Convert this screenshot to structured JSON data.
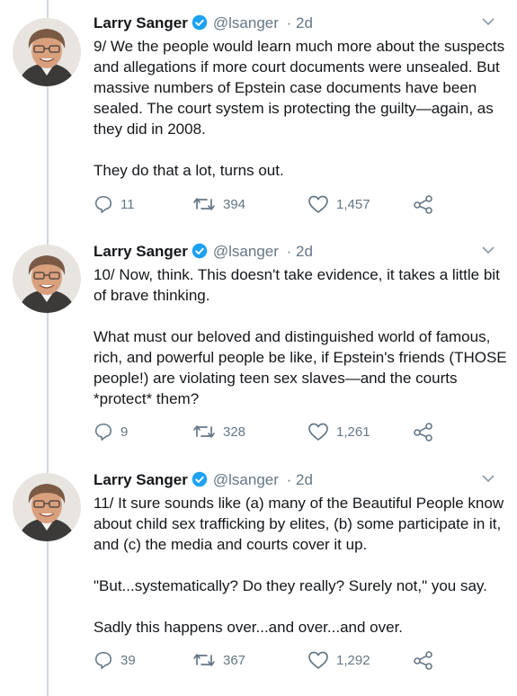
{
  "tweets": [
    {
      "name": "Larry Sanger",
      "handle": "@lsanger",
      "time": "· 2d",
      "text": "9/ We the people would learn much more about the suspects and allegations if more court documents were unsealed. But massive numbers of Epstein case documents have been sealed. The court system is protecting the guilty—again, as they did in 2008.\n\nThey do that a lot, turns out.",
      "replies": "11",
      "retweets": "394",
      "likes": "1,457"
    },
    {
      "name": "Larry Sanger",
      "handle": "@lsanger",
      "time": "· 2d",
      "text": "10/ Now, think. This doesn't take evidence, it takes a little bit of brave thinking.\n\nWhat must our beloved and distinguished world of famous, rich, and powerful people be like, if Epstein's friends (THOSE people!) are violating teen sex slaves—and the courts *protect* them?",
      "replies": "9",
      "retweets": "328",
      "likes": "1,261"
    },
    {
      "name": "Larry Sanger",
      "handle": "@lsanger",
      "time": "· 2d",
      "text": "11/ It sure sounds like (a) many of the Beautiful People know about child sex trafficking by elites, (b) some participate in it, and (c) the media and courts cover it up.\n\n\"But...systematically? Do they really? Surely not,\" you say.\n\nSadly this happens over...and over...and over.",
      "replies": "39",
      "retweets": "367",
      "likes": "1,292"
    }
  ],
  "icons": {
    "verified": "verified-badge-icon",
    "chevron": "chevron-down-icon",
    "reply": "reply-icon",
    "retweet": "retweet-icon",
    "like": "heart-icon",
    "share": "share-icon"
  },
  "colors": {
    "text": "#14171a",
    "muted": "#657786",
    "verified": "#1da1f2",
    "thread_line": "#cfd9de"
  }
}
